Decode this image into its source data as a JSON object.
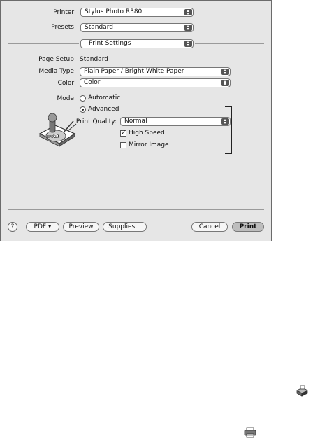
{
  "dialog": {
    "printer": {
      "label": "Printer:",
      "value": "Stylus Photo R380"
    },
    "presets": {
      "label": "Presets:",
      "value": "Standard"
    },
    "panel": {
      "value": "Print Settings"
    },
    "page_setup": {
      "label": "Page Setup:",
      "value": "Standard"
    },
    "media_type": {
      "label": "Media Type:",
      "value": "Plain Paper / Bright White Paper"
    },
    "color": {
      "label": "Color:",
      "value": "Color"
    },
    "mode": {
      "label": "Mode:",
      "automatic": "Automatic",
      "advanced": "Advanced",
      "selected": "Advanced"
    },
    "print_quality": {
      "label": "Print Quality:",
      "value": "Normal"
    },
    "high_speed": {
      "label": "High Speed",
      "checked": true,
      "mark": "✓"
    },
    "mirror_image": {
      "label": "Mirror Image",
      "checked": false
    },
    "footer": {
      "help_label": "?",
      "pdf_label": "PDF ▾",
      "preview_label": "Preview",
      "supplies_label": "Supplies...",
      "cancel_label": "Cancel",
      "print_label": "Print"
    }
  },
  "icons": [
    "epson-printer-illustration-icon",
    "page-setup-icon",
    "printer-icon"
  ]
}
